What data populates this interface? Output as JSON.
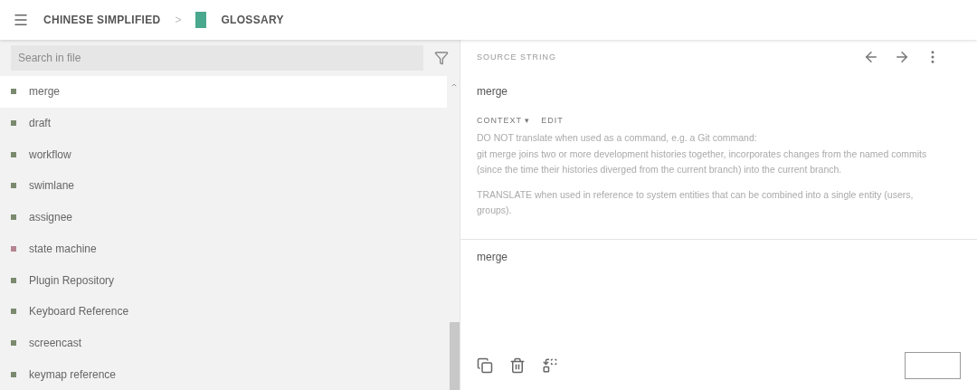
{
  "header": {
    "breadcrumb": [
      "CHINESE SIMPLIFIED",
      "GLOSSARY"
    ],
    "separator": ">"
  },
  "search": {
    "placeholder": "Search in file"
  },
  "terms": [
    {
      "label": "merge",
      "selected": true,
      "color": "#7b8a6e"
    },
    {
      "label": "draft",
      "selected": false,
      "color": "#7b8a6e"
    },
    {
      "label": "workflow",
      "selected": false,
      "color": "#7b8a6e"
    },
    {
      "label": "swimlane",
      "selected": false,
      "color": "#7b8a6e"
    },
    {
      "label": "assignee",
      "selected": false,
      "color": "#7b8a6e"
    },
    {
      "label": "state machine",
      "selected": false,
      "color": "#b58592"
    },
    {
      "label": "Plugin Repository",
      "selected": false,
      "color": "#7b8a6e"
    },
    {
      "label": "Keyboard Reference",
      "selected": false,
      "color": "#7b8a6e"
    },
    {
      "label": "screencast",
      "selected": false,
      "color": "#7b8a6e"
    },
    {
      "label": "keymap reference",
      "selected": false,
      "color": "#7b8a6e"
    }
  ],
  "source": {
    "heading": "SOURCE STRING",
    "text": "merge",
    "context_label": "CONTEXT",
    "context_caret": "▾",
    "edit_label": "EDIT",
    "context_paragraphs": [
      "DO NOT translate when used as a command, e.g. a Git command:\ngit merge joins two or more development histories together, incorporates changes from the named commits (since the time their histories diverged from the current branch) into the current branch.",
      "TRANSLATE when used in reference to system entities that can be combined into a single entity (users, groups)."
    ]
  },
  "translation": {
    "value": "merge"
  }
}
